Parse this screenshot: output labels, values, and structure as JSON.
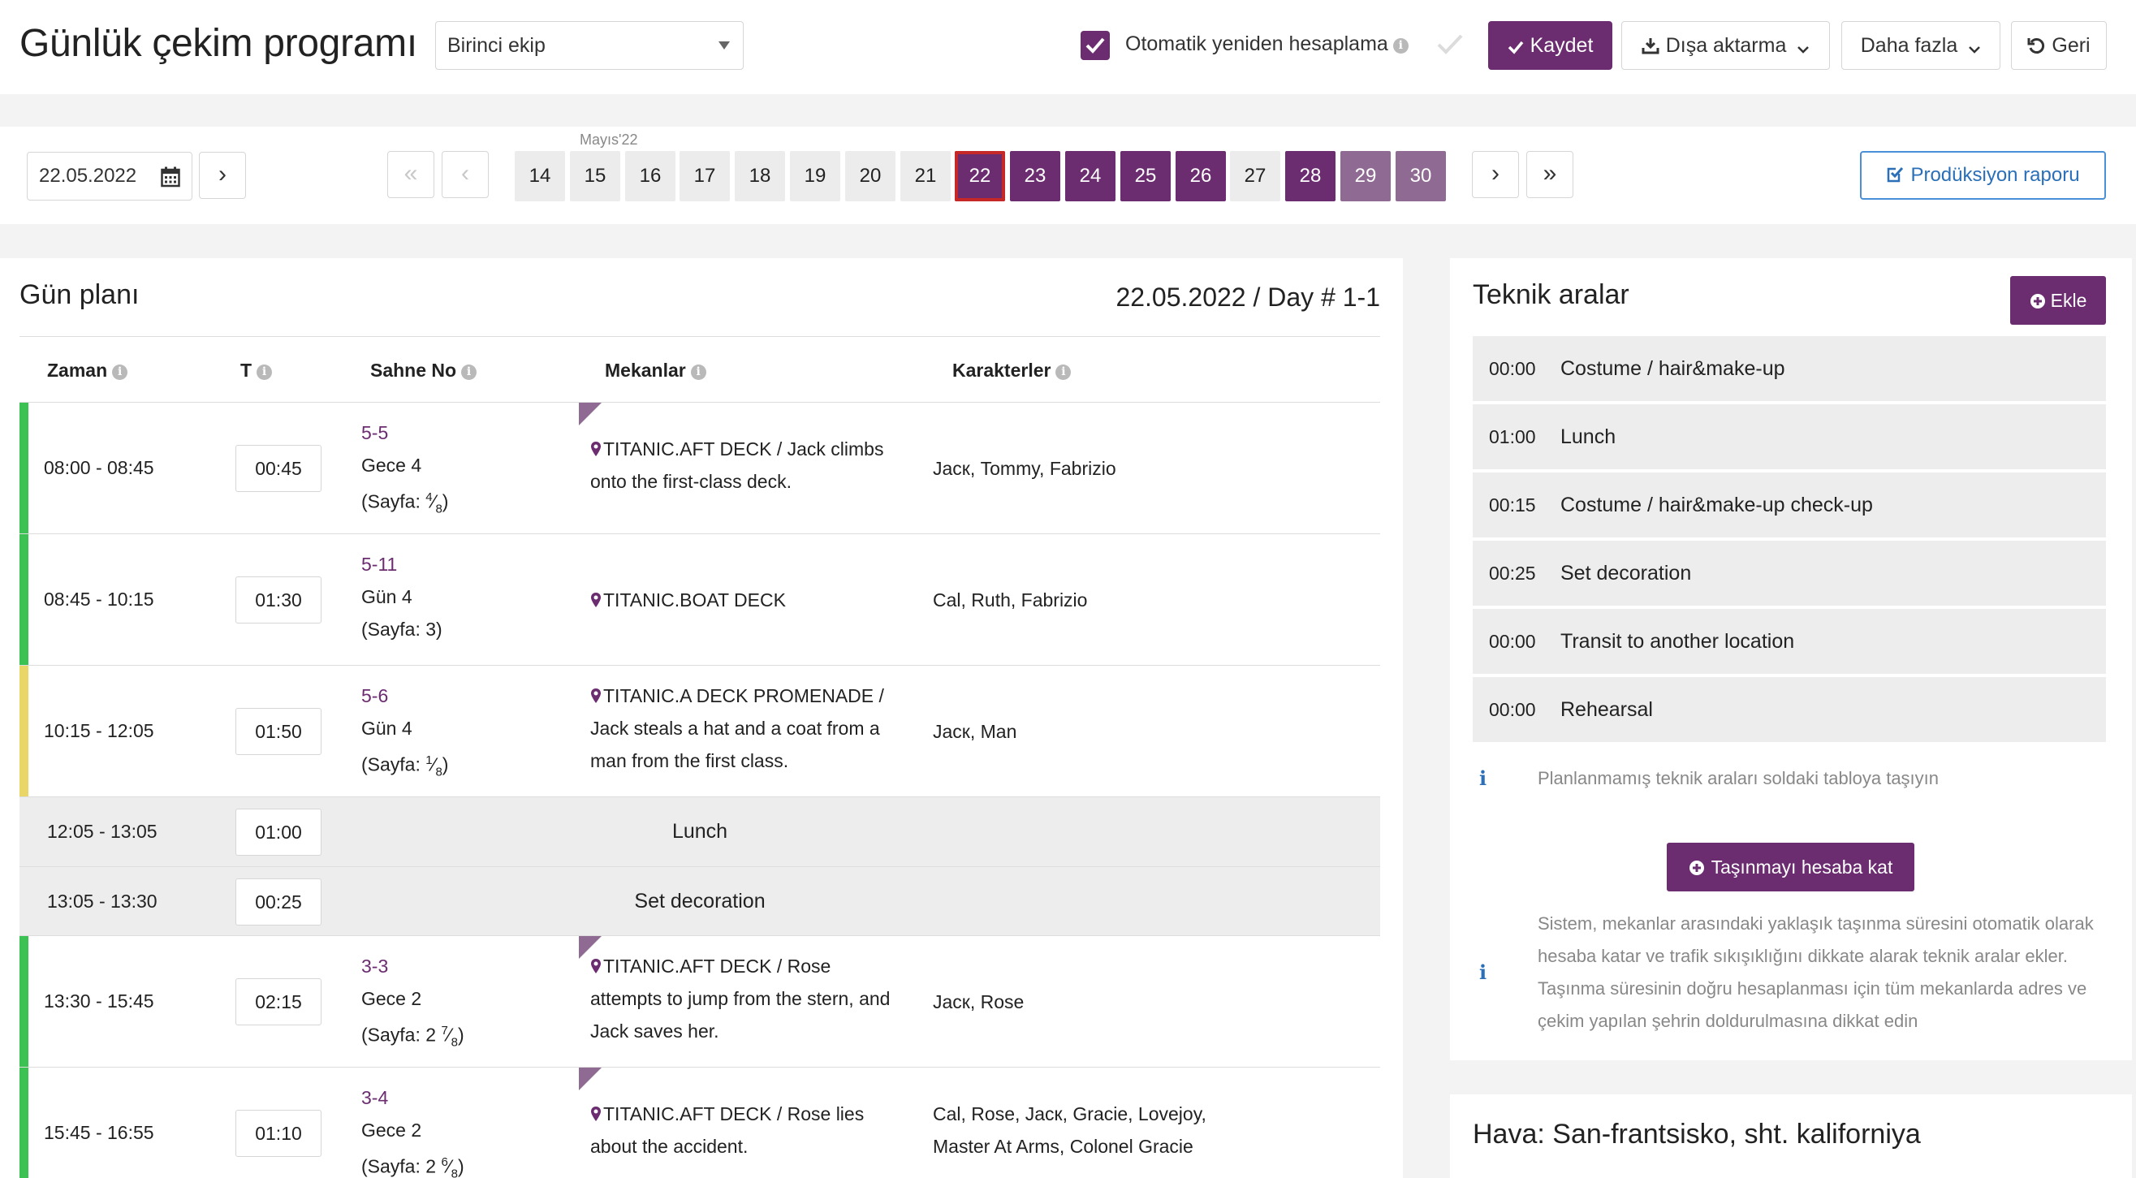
{
  "header": {
    "title": "Günlük çekim programı",
    "crew_select": "Birinci ekip",
    "auto_recalc_label": "Otomatik yeniden hesaplama",
    "auto_recalc_checked": true,
    "save_label": "Kaydet",
    "export_label": "Dışa aktarma",
    "more_label": "Daha fazla",
    "back_label": "Geri"
  },
  "datebar": {
    "current_date": "22.05.2022",
    "month_label": "Mayıs'22",
    "days": [
      {
        "label": "14",
        "state": "plain"
      },
      {
        "label": "15",
        "state": "plain"
      },
      {
        "label": "16",
        "state": "plain"
      },
      {
        "label": "17",
        "state": "plain"
      },
      {
        "label": "18",
        "state": "plain"
      },
      {
        "label": "19",
        "state": "plain"
      },
      {
        "label": "20",
        "state": "plain"
      },
      {
        "label": "21",
        "state": "plain"
      },
      {
        "label": "22",
        "state": "selected"
      },
      {
        "label": "23",
        "state": "scheduled"
      },
      {
        "label": "24",
        "state": "scheduled"
      },
      {
        "label": "25",
        "state": "scheduled"
      },
      {
        "label": "26",
        "state": "scheduled"
      },
      {
        "label": "27",
        "state": "plain"
      },
      {
        "label": "28",
        "state": "scheduled"
      },
      {
        "label": "29",
        "state": "scheduled-light"
      },
      {
        "label": "30",
        "state": "scheduled-light"
      }
    ],
    "report_label": "Prodüksiyon raporu"
  },
  "plan": {
    "title": "Gün planı",
    "date_day": "22.05.2022 / Day # 1-1",
    "columns": {
      "time": "Zaman",
      "t": "T",
      "scene_no": "Sahne No",
      "locations": "Mekanlar",
      "characters": "Karakterler"
    },
    "rows": [
      {
        "type": "scene",
        "time": "08:00 - 08:45",
        "dur": "00:45",
        "scene_no": "5-5",
        "daynight": "Gece 4",
        "page_pre": "(Sayfa: ",
        "page_whole": "",
        "page_num": "4",
        "page_den": "8",
        "page_post": ")",
        "location": "TITANIC.AFT DECK / Jack climbs onto the first-class deck.",
        "characters": "Jacк, Tommy, Fabrizio",
        "flag": true,
        "color": "#3cc153"
      },
      {
        "type": "scene",
        "time": "08:45 - 10:15",
        "dur": "01:30",
        "scene_no": "5-11",
        "daynight": "Gün 4",
        "page_pre": "(Sayfa: 3)",
        "page_whole": "",
        "page_num": "",
        "page_den": "",
        "page_post": "",
        "location": "TITANIC.BOAT DECK",
        "characters": "Cal, Ruth, Fabrizio",
        "flag": false,
        "color": "#3cc153"
      },
      {
        "type": "scene",
        "time": "10:15 - 12:05",
        "dur": "01:50",
        "scene_no": "5-6",
        "daynight": "Gün 4",
        "page_pre": "(Sayfa: ",
        "page_whole": "",
        "page_num": "1",
        "page_den": "8",
        "page_post": ")",
        "location": "TITANIC.A DECK PROMENADE / Jack steals a hat and a coat from a man from the first class.",
        "characters": "Jacк, Man",
        "flag": false,
        "color": "#ead667"
      },
      {
        "type": "break",
        "time": "12:05 - 13:05",
        "dur": "01:00",
        "label": "Lunch"
      },
      {
        "type": "break",
        "time": "13:05 - 13:30",
        "dur": "00:25",
        "label": "Set decoration"
      },
      {
        "type": "scene",
        "time": "13:30 - 15:45",
        "dur": "02:15",
        "scene_no": "3-3",
        "daynight": "Gece 2",
        "page_pre": "(Sayfa: 2 ",
        "page_whole": "",
        "page_num": "7",
        "page_den": "8",
        "page_post": ")",
        "location": "TITANIC.AFT DECK / Rose attempts to jump from the stern, and Jack saves her.",
        "characters": "Jacк, Rose",
        "flag": true,
        "color": "#3cc153"
      },
      {
        "type": "scene",
        "time": "15:45 - 16:55",
        "dur": "01:10",
        "scene_no": "3-4",
        "daynight": "Gece 2",
        "page_pre": "(Sayfa: 2 ",
        "page_whole": "",
        "page_num": "6",
        "page_den": "8",
        "page_post": ")",
        "location": "TITANIC.AFT DECK / Rose lies about the accident.",
        "characters": "Cal, Rose, Jacк, Gracie, Lovejoy, Master At Arms, Colonel Gracie",
        "flag": true,
        "color": "#3cc153"
      }
    ]
  },
  "tech": {
    "title": "Teknik aralar",
    "add_label": "Ekle",
    "items": [
      {
        "time": "00:00",
        "name": "Costume / hair&make-up"
      },
      {
        "time": "01:00",
        "name": "Lunch"
      },
      {
        "time": "00:15",
        "name": "Costume / hair&make-up check-up"
      },
      {
        "time": "00:25",
        "name": "Set decoration"
      },
      {
        "time": "00:00",
        "name": "Transit to another location"
      },
      {
        "time": "00:00",
        "name": "Rehearsal"
      }
    ],
    "drag_hint": "Planlanmamış teknik araları soldaki tabloya taşıyın",
    "transit_label": "Taşınmayı hesaba kat",
    "transit_note": "Sistem, mekanlar arasındaki yaklaşık taşınma süresini otomatik olarak hesaba katar ve trafik sıkışıklığını dikkate alarak teknik aralar ekler. Taşınma süresinin doğru hesaplanması için tüm mekanlarda adres ve çekim yapılan şehrin doldurulmasına dikkat edin"
  },
  "weather": {
    "title": "Hava: San-frantsisko, sht. kaliforniya"
  },
  "colors": {
    "brand": "#6b2c70",
    "brand_light": "#8f6a92",
    "selected_outline": "#c62828",
    "scene_ok": "#3cc153",
    "scene_warn": "#ead667",
    "link_blue": "#2a6fb8"
  },
  "icons": [
    "check-icon",
    "download-icon",
    "chevron-down-icon",
    "undo-icon",
    "calendar-icon",
    "chevron-right-icon",
    "double-chevron-left-icon",
    "chevron-left-icon",
    "double-chevron-right-icon",
    "edit-check-icon",
    "info-icon",
    "map-pin-icon",
    "plus-circle-icon"
  ]
}
